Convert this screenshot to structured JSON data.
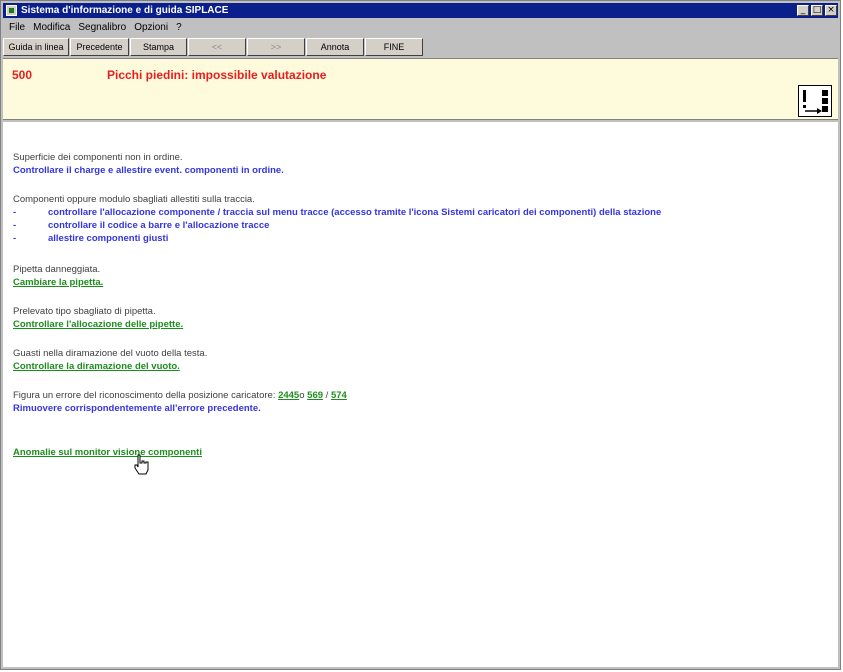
{
  "window": {
    "title": "Sistema d'informazione e di guida SIPLACE",
    "buttons": {
      "minimize": "_",
      "maximize": "□",
      "close": "×"
    }
  },
  "menubar": [
    "File",
    "Modifica",
    "Segnalibro",
    "Opzioni",
    "?"
  ],
  "toolbar": [
    {
      "label": "Guida in linea",
      "enabled": true
    },
    {
      "label": "Precedente",
      "enabled": true
    },
    {
      "label": "Stampa",
      "enabled": true
    },
    {
      "label": "<<",
      "enabled": false
    },
    {
      "label": ">>",
      "enabled": false
    },
    {
      "label": "Annota",
      "enabled": true
    },
    {
      "label": "FINE",
      "enabled": true
    }
  ],
  "error": {
    "code": "500",
    "title": "Picchi piedini: impossibile valutazione"
  },
  "content": {
    "s1_cause": "Superficie dei componenti non in ordine.",
    "s1_action": "Controllare il charge e allestire event. componenti in ordine.",
    "s2_cause": "Componenti oppure modulo sbagliati allestiti sulla traccia.",
    "s2_bullets": [
      {
        "dash": "-",
        "text": "controllare l'allocazione componente / traccia sul menu tracce (accesso tramite l'icona Sistemi caricatori dei componenti) della stazione"
      },
      {
        "dash": "-",
        "text": "controllare il codice a barre e l'allocazione tracce"
      },
      {
        "dash": "-",
        "text": "allestire componenti giusti"
      }
    ],
    "s3_cause": "Pipetta danneggiata.",
    "s3_link": "Cambiare la pipetta.",
    "s4_cause": "Prelevato tipo sbagliato di pipetta.",
    "s4_link": "Controllare l'allocazione delle pipette.",
    "s5_cause": "Guasti nella diramazione del vuoto della testa.",
    "s5_link": "Controllare la diramazione del vuoto.",
    "s6_prefix": "Figura un errore del riconoscimento della posizione caricatore:",
    "s6_link1": "2445",
    "s6_sep1": "o",
    "s6_link2": "569",
    "s6_sep2": "/",
    "s6_link3": "574",
    "s6_action": "Rimuovere corrispondentemente all'errore precedente.",
    "s7_link": "Anomalie sul monitor visione componenti"
  }
}
